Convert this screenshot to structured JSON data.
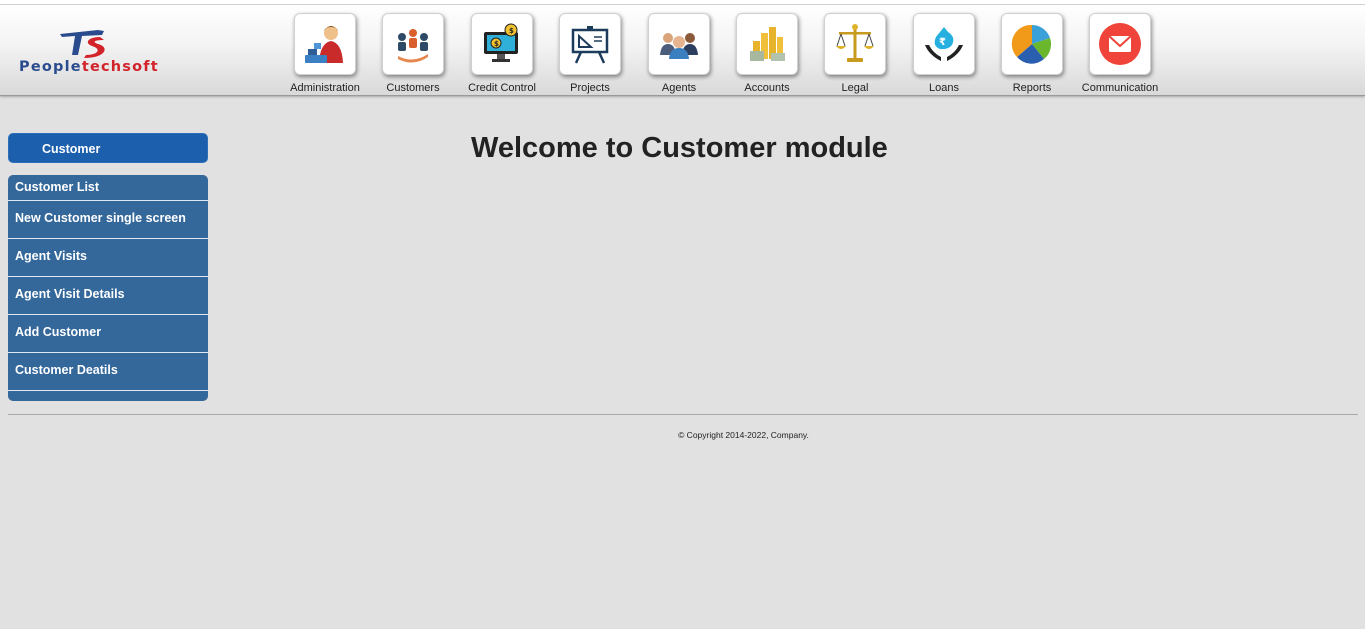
{
  "logo": {
    "part1": "People",
    "part2": "techsoft"
  },
  "nav": [
    {
      "label": "Administration",
      "icon": "administration-icon"
    },
    {
      "label": "Customers",
      "icon": "customers-icon"
    },
    {
      "label": "Credit Control",
      "icon": "credit-control-icon"
    },
    {
      "label": "Projects",
      "icon": "projects-icon"
    },
    {
      "label": "Agents",
      "icon": "agents-icon"
    },
    {
      "label": "Accounts",
      "icon": "accounts-icon"
    },
    {
      "label": "Legal",
      "icon": "legal-icon"
    },
    {
      "label": "Loans",
      "icon": "loans-icon"
    },
    {
      "label": "Reports",
      "icon": "reports-icon"
    },
    {
      "label": "Communication",
      "icon": "communication-icon"
    }
  ],
  "sidebar": {
    "header": "Customer",
    "items": [
      {
        "label": "Customer List"
      },
      {
        "label": "New Customer single screen"
      },
      {
        "label": "Agent Visits"
      },
      {
        "label": "Agent Visit Details"
      },
      {
        "label": "Add Customer"
      },
      {
        "label": "Customer Deatils"
      }
    ]
  },
  "main": {
    "title": "Welcome to Customer module"
  },
  "footer": {
    "copyright": "© Copyright 2014-2022, Company."
  },
  "colors": {
    "sidebar_header": "#1c5fad",
    "sidebar_list": "#34679a",
    "background": "#e1e1e1",
    "logo_blue": "#2a4c8e",
    "logo_red": "#d2232a"
  }
}
